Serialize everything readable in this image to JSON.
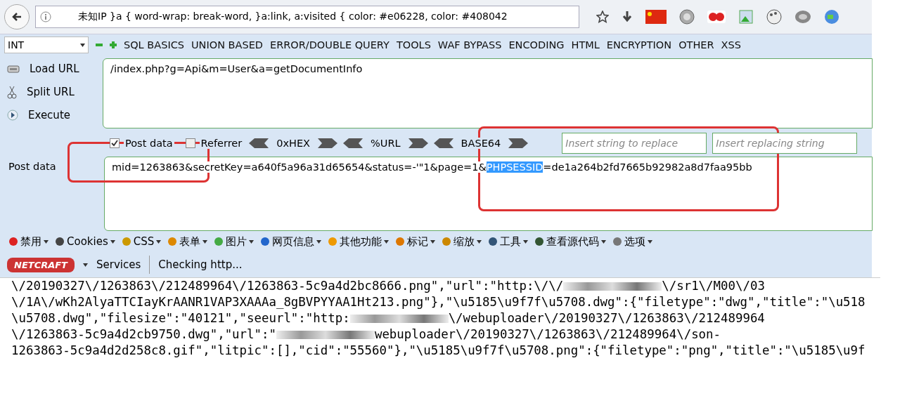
{
  "address_bar": {
    "value": "未知IP   }a { word-wrap: break-word, }a:link, a:visited { color: #e06228, color: #408042"
  },
  "hackbar": {
    "select": "INT",
    "menus": [
      "SQL BASICS",
      "UNION BASED",
      "ERROR/DOUBLE QUERY",
      "TOOLS",
      "WAF BYPASS",
      "ENCODING",
      "HTML",
      "ENCRYPTION",
      "OTHER",
      "XSS"
    ],
    "actions": [
      {
        "label": "Load URL",
        "kind": "load"
      },
      {
        "label": "Split URL",
        "kind": "split"
      },
      {
        "label": "Execute",
        "kind": "execute"
      }
    ],
    "url": "/index.php?g=Api&m=User&a=getDocumentInfo",
    "post_checkbox": {
      "label": "Post data",
      "checked": true
    },
    "referrer_checkbox": {
      "label": "Referrer",
      "checked": false
    },
    "encoders": [
      "0xHEX",
      "%URL",
      "BASE64"
    ],
    "replace_placeholder": "Insert string to replace",
    "replacing_placeholder": "Insert replacing string",
    "post_label": "Post data",
    "post_before": "mid=1263863&secretKey=a640f5a96a31d65654&status=-'\"1&page=1&",
    "post_selected": "PHPSESSID",
    "post_after": "=de1a264b2fd7665b92982a8d7faa95bb"
  },
  "webdev_toolbar": [
    {
      "label": "禁用",
      "kind": "disable"
    },
    {
      "label": "Cookies",
      "kind": "cookie"
    },
    {
      "label": "CSS",
      "kind": "css"
    },
    {
      "label": "表单",
      "kind": "form"
    },
    {
      "label": "图片",
      "kind": "image"
    },
    {
      "label": "网页信息",
      "kind": "info"
    },
    {
      "label": "其他功能",
      "kind": "misc"
    },
    {
      "label": "标记",
      "kind": "mark"
    },
    {
      "label": "缩放",
      "kind": "zoom"
    },
    {
      "label": "工具",
      "kind": "tools"
    },
    {
      "label": "查看源代码",
      "kind": "source"
    },
    {
      "label": "选项",
      "kind": "options"
    }
  ],
  "netcraft": {
    "logo": "NETCRAFT",
    "services": "Services",
    "status": "Checking http..."
  },
  "response_lines": [
    {
      "text": "\\/20190327\\/1263863\\/212489964\\/1263863-5c9a4d2bc8666.png\",\"url\":\"http:\\/\\/",
      "tail": "\\/sr1\\/M00\\/03"
    },
    {
      "text": "\\/1A\\/wKh2AlyaTTCIayKrAANR1VAP3XAAAa_8gBVPYYAA1Ht213.png\"},\"\\u5185\\u9f7f\\u5708.dwg\":{\"filetype\":\"dwg\",\"title\":\"\\u518"
    },
    {
      "text": "\\u5708.dwg\",\"filesize\":\"40121\",\"seeurl\":\"http:",
      "tail": "\\/webuploader\\/20190327\\/1263863\\/212489964"
    },
    {
      "text": "\\/1263863-5c9a4d2cb9750.dwg\",\"url\":\"",
      "tail": "webuploader\\/20190327\\/1263863\\/212489964\\/son-"
    },
    {
      "text": "1263863-5c9a4d2d258c8.gif\",\"litpic\":[],\"cid\":\"55560\"},\"\\u5185\\u9f7f\\u5708.png\":{\"filetype\":\"png\",\"title\":\"\\u5185\\u9f"
    }
  ]
}
